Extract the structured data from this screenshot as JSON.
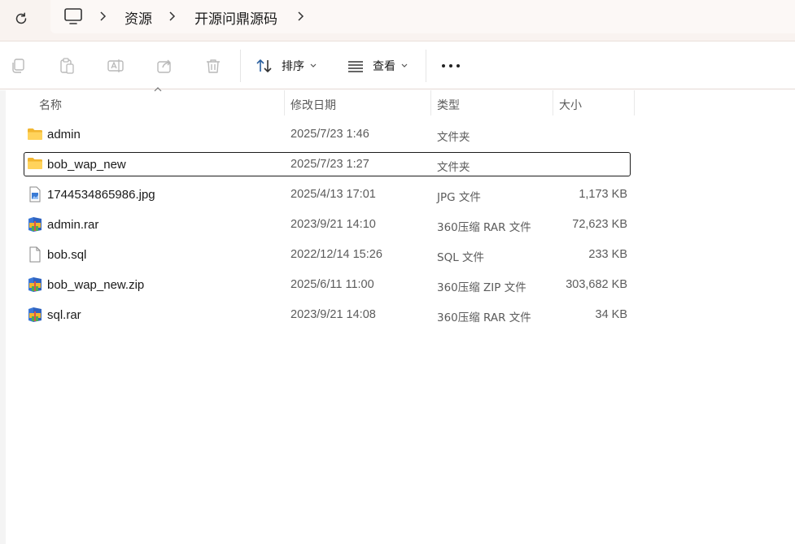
{
  "breadcrumb": {
    "items": [
      "资源",
      "开源问鼎源码"
    ]
  },
  "toolbar": {
    "sort_label": "排序",
    "view_label": "查看"
  },
  "columns": {
    "name": "名称",
    "modified": "修改日期",
    "type": "类型",
    "size": "大小"
  },
  "files": [
    {
      "name": "admin",
      "modified": "2025/7/23 1:46",
      "type": "文件夹",
      "size": "",
      "icon": "folder-icon"
    },
    {
      "name": "bob_wap_new",
      "modified": "2025/7/23 1:27",
      "type": "文件夹",
      "size": "",
      "icon": "folder-icon"
    },
    {
      "name": "1744534865986.jpg",
      "modified": "2025/4/13 17:01",
      "type": "JPG 文件",
      "size": "1,173 KB",
      "icon": "image-file-icon"
    },
    {
      "name": "admin.rar",
      "modified": "2023/9/21 14:10",
      "type": "360压缩 RAR 文件",
      "size": "72,623 KB",
      "icon": "archive-icon"
    },
    {
      "name": "bob.sql",
      "modified": "2022/12/14 15:26",
      "type": "SQL 文件",
      "size": "233 KB",
      "icon": "file-icon"
    },
    {
      "name": "bob_wap_new.zip",
      "modified": "2025/6/11 11:00",
      "type": "360压缩 ZIP 文件",
      "size": "303,682 KB",
      "icon": "archive-icon"
    },
    {
      "name": "sql.rar",
      "modified": "2023/9/21 14:08",
      "type": "360压缩 RAR 文件",
      "size": "34 KB",
      "icon": "archive-icon"
    }
  ],
  "selected_index": 1,
  "colors": {
    "address_bar_bg": "#f9f3f0",
    "folder_yellow": "#f6c44f",
    "archive_blue": "#3b78d8"
  }
}
